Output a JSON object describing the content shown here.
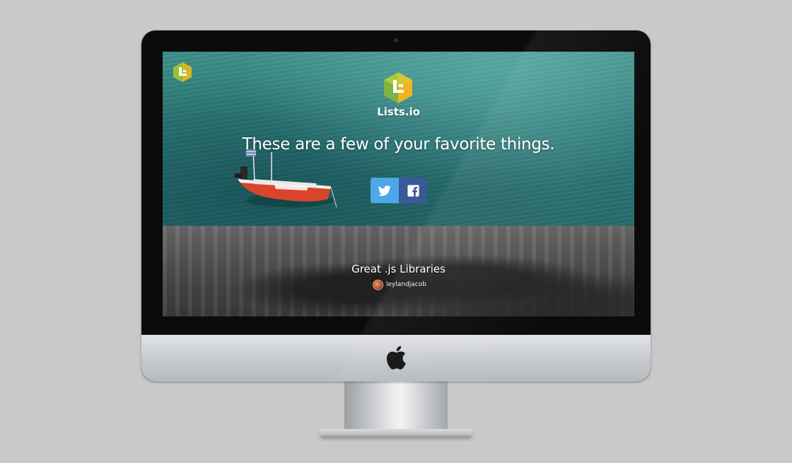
{
  "app": {
    "brand_name": "Lists.io",
    "tagline": "These are a few of your favorite things."
  },
  "share": {
    "twitter_icon": "twitter-bird-icon",
    "facebook_icon": "facebook-f-icon",
    "twitter_color": "#4da7e8",
    "facebook_color": "#3b5998"
  },
  "featured_list": {
    "title": "Great .js Libraries",
    "author": "leylandjacob"
  },
  "device": {
    "frame": "imac-monitor",
    "logo_icon": "apple-logo-icon"
  }
}
